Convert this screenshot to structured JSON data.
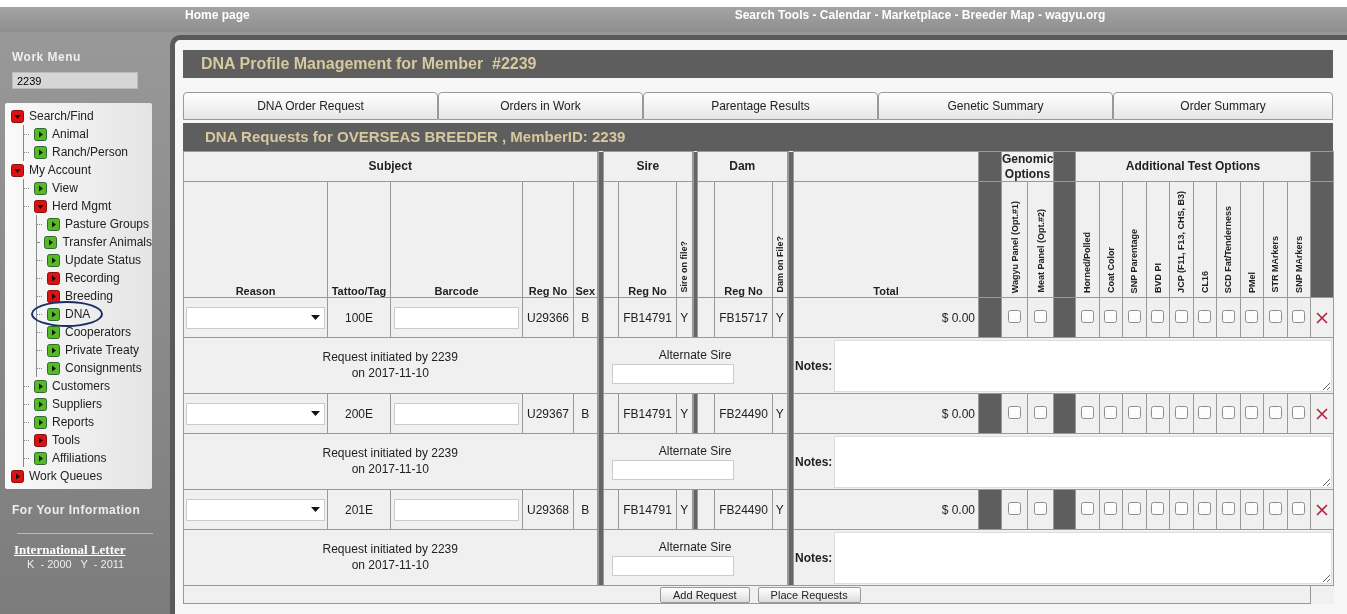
{
  "top_bar": {
    "home_link": "Home page",
    "links": "Search Tools - Calendar - Marketplace - Breeder Map - wagyu.org"
  },
  "sidebar": {
    "title": "Work Menu",
    "member_field": "2239",
    "tree": [
      {
        "label": "Search/Find",
        "kind": "open",
        "circled": false,
        "children": [
          {
            "label": "Animal",
            "kind": "leaf",
            "circled": false
          },
          {
            "label": "Ranch/Person",
            "kind": "leaf",
            "circled": false
          }
        ]
      },
      {
        "label": "My Account",
        "kind": "open",
        "circled": false,
        "children": [
          {
            "label": "View",
            "kind": "leaf",
            "circled": false
          },
          {
            "label": "Herd Mgmt",
            "kind": "open",
            "circled": false,
            "children": [
              {
                "label": "Pasture Groups",
                "kind": "leaf",
                "circled": false
              },
              {
                "label": "Transfer Animals",
                "kind": "leaf",
                "circled": false
              },
              {
                "label": "Update Status",
                "kind": "leaf",
                "circled": false
              },
              {
                "label": "Recording",
                "kind": "closed",
                "circled": false
              },
              {
                "label": "Breeding",
                "kind": "closed",
                "circled": false
              },
              {
                "label": "DNA",
                "kind": "leaf",
                "circled": true
              },
              {
                "label": "Cooperators",
                "kind": "leaf",
                "circled": false
              },
              {
                "label": "Private Treaty",
                "kind": "leaf",
                "circled": false
              },
              {
                "label": "Consignments",
                "kind": "leaf",
                "circled": false
              }
            ]
          },
          {
            "label": "Customers",
            "kind": "leaf",
            "circled": false
          },
          {
            "label": "Suppliers",
            "kind": "leaf",
            "circled": false
          },
          {
            "label": "Reports",
            "kind": "leaf",
            "circled": false
          },
          {
            "label": "Tools",
            "kind": "closed",
            "circled": false
          },
          {
            "label": "Affiliations",
            "kind": "leaf",
            "circled": false
          }
        ]
      },
      {
        "label": "Work Queues",
        "kind": "closed",
        "circled": false
      }
    ],
    "info_title": "For Your Information",
    "letter_link": "International Letter",
    "letter_codes": "K  - 2000   Y  - 2011"
  },
  "page_title": "DNA Profile Management for Member  #2239",
  "tabs": [
    {
      "label": "DNA Order Request"
    },
    {
      "label": "Orders in Work"
    },
    {
      "label": "Parentage Results"
    },
    {
      "label": "Genetic Summary"
    },
    {
      "label": "Order Summary"
    }
  ],
  "section_title": "DNA Requests for OVERSEAS BREEDER , MemberID: 2239",
  "table": {
    "subject_group": "Subject",
    "sire_group": "Sire",
    "dam_group": "Dam",
    "genomic_group": "Genomic Options",
    "tests_group": "Additional Test Options",
    "subject_columns": [
      "Reason",
      "Tattoo/Tag",
      "Barcode",
      "Reg No",
      "Sex"
    ],
    "sire_columns": [
      "Reg No",
      "Sire on file?"
    ],
    "dam_columns": [
      "Reg No",
      "Dam on File?"
    ],
    "total_column": "Total",
    "genomic_columns": [
      "Wagyu Panel (Opt.#1)",
      "Meat Panel (Opt.#2)"
    ],
    "test_columns": [
      "Horned/Polled",
      "Coat Color",
      "SNP Parentage",
      "BVD PI",
      "JCP (F11, F13, CHS, B3)",
      "CL16",
      "SCD Fat/Tenderness",
      "PMel",
      "STR MArkers",
      "SNP MArkers"
    ],
    "requests": [
      {
        "tattoo": "100E",
        "reg_no": "U29366",
        "sex": "B",
        "sire_reg_no": "FB14791",
        "sire_on_file": "Y",
        "dam_reg_no": "FB15717",
        "dam_on_file": "Y",
        "total": "$ 0.00",
        "genomic": [
          {
            "checked": false
          },
          {
            "checked": false
          }
        ],
        "tests": [
          {
            "checked": false
          },
          {
            "checked": false
          },
          {
            "checked": false
          },
          {
            "checked": false
          },
          {
            "checked": false
          },
          {
            "checked": false
          },
          {
            "checked": false
          },
          {
            "checked": false
          },
          {
            "checked": false
          },
          {
            "checked": false
          }
        ],
        "initiated": [
          "Request initiated by 2239",
          "on 2017-11-10"
        ],
        "alternate_sire_label": "Alternate Sire",
        "notes_label": "Notes:"
      },
      {
        "tattoo": "200E",
        "reg_no": "U29367",
        "sex": "B",
        "sire_reg_no": "FB14791",
        "sire_on_file": "Y",
        "dam_reg_no": "FB24490",
        "dam_on_file": "Y",
        "total": "$ 0.00",
        "genomic": [
          {
            "checked": false
          },
          {
            "checked": false
          }
        ],
        "tests": [
          {
            "checked": false
          },
          {
            "checked": false
          },
          {
            "checked": false
          },
          {
            "checked": false
          },
          {
            "checked": false
          },
          {
            "checked": false
          },
          {
            "checked": false
          },
          {
            "checked": false
          },
          {
            "checked": false
          },
          {
            "checked": false
          }
        ],
        "initiated": [
          "Request initiated by 2239",
          "on 2017-11-10"
        ],
        "alternate_sire_label": "Alternate Sire",
        "notes_label": "Notes:"
      },
      {
        "tattoo": "201E",
        "reg_no": "U29368",
        "sex": "B",
        "sire_reg_no": "FB14791",
        "sire_on_file": "Y",
        "dam_reg_no": "FB24490",
        "dam_on_file": "Y",
        "total": "$ 0.00",
        "genomic": [
          {
            "checked": false
          },
          {
            "checked": false
          }
        ],
        "tests": [
          {
            "checked": false
          },
          {
            "checked": false
          },
          {
            "checked": false
          },
          {
            "checked": false
          },
          {
            "checked": false
          },
          {
            "checked": false
          },
          {
            "checked": false
          },
          {
            "checked": false
          },
          {
            "checked": false
          },
          {
            "checked": false
          }
        ],
        "initiated": [
          "Request initiated by 2239",
          "on 2017-11-10"
        ],
        "alternate_sire_label": "Alternate Sire",
        "notes_label": "Notes:"
      }
    ]
  },
  "buttons": [
    "Add Request",
    "Place Requests"
  ]
}
